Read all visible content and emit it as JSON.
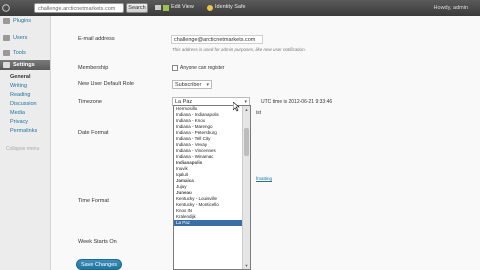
{
  "topbar": {
    "site_url": "challenge.arcticnetmarkets.com",
    "search_placeholder": "",
    "search_button": "Search",
    "edit_view": "Edit View",
    "identity": "Identity Safe",
    "howdy": "Howdy, admin"
  },
  "sidebar": {
    "items": [
      {
        "label": "Plugins",
        "icon": "plugin-icon"
      },
      {
        "label": "Users",
        "icon": "users-icon"
      },
      {
        "label": "Tools",
        "icon": "tools-icon"
      },
      {
        "label": "Settings",
        "icon": "settings-icon"
      }
    ],
    "sub": [
      "General",
      "Writing",
      "Reading",
      "Discussion",
      "Media",
      "Privacy",
      "Permalinks"
    ],
    "collapse": "Collapse menu"
  },
  "form": {
    "email_label": "E-mail address",
    "email_value": "challenge@arcticnetmarkets.com",
    "email_desc": "This address is used for admin purposes, like new user notification.",
    "membership_label": "Membership",
    "membership_check": "Anyone can register",
    "role_label": "New User Default Role",
    "role_value": "Subscriber",
    "timezone_label": "Timezone",
    "timezone_value": "La Paz",
    "utc_text": "UTC time is  2012-06-21 9:33:46",
    "local_text": "ist",
    "date_label": "Date Format",
    "time_label": "Time Format",
    "week_label": "Week Starts On",
    "date_link": "fmatting",
    "save_button": "Save Changes"
  },
  "timezone_options": [
    {
      "label": "Hermosillo",
      "group": false
    },
    {
      "label": "Indiana - Indianapolis",
      "group": false
    },
    {
      "label": "Indiana - Knox",
      "group": false
    },
    {
      "label": "Indiana - Marengo",
      "group": false
    },
    {
      "label": "Indiana - Petersburg",
      "group": false
    },
    {
      "label": "Indiana - Tell City",
      "group": false
    },
    {
      "label": "Indiana - Vevay",
      "group": false
    },
    {
      "label": "Indiana - Vincennes",
      "group": false
    },
    {
      "label": "Indiana - Winamac",
      "group": false
    },
    {
      "label": "Indianapolis",
      "group": true
    },
    {
      "label": "Inuvik",
      "group": false
    },
    {
      "label": "Iqaluit",
      "group": false
    },
    {
      "label": "Jamaica",
      "group": true
    },
    {
      "label": "Jujuy",
      "group": false
    },
    {
      "label": "Juneau",
      "group": true
    },
    {
      "label": "Kentucky - Louisville",
      "group": false
    },
    {
      "label": "Kentucky - Monticello",
      "group": false
    },
    {
      "label": "Knox IN",
      "group": false
    },
    {
      "label": "Kralendijk",
      "group": false
    },
    {
      "label": "La Paz",
      "group": false,
      "selected": true
    }
  ]
}
